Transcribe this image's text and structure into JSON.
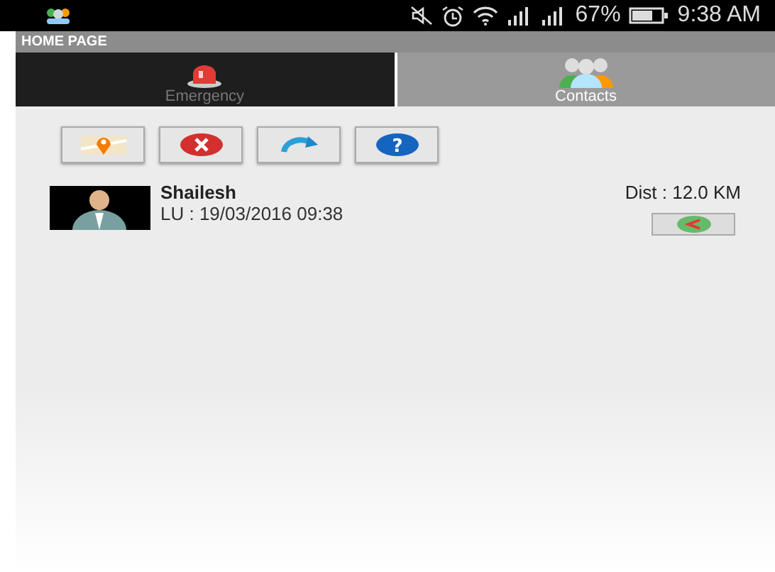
{
  "status_bar": {
    "battery": "67%",
    "time": "9:38 AM"
  },
  "title": "HOME PAGE",
  "tabs": [
    {
      "label": "Emergency",
      "kind": "siren",
      "selected": false
    },
    {
      "label": "Contacts",
      "kind": "people",
      "selected": true
    }
  ],
  "toolbar": [
    {
      "kind": "map"
    },
    {
      "kind": "delete"
    },
    {
      "kind": "refresh"
    },
    {
      "kind": "help",
      "glyph": "?"
    }
  ],
  "contacts": [
    {
      "name": "Shailesh",
      "last_update": "LU : 19/03/2016 09:38",
      "distance": "Dist : 12.0 KM"
    }
  ]
}
